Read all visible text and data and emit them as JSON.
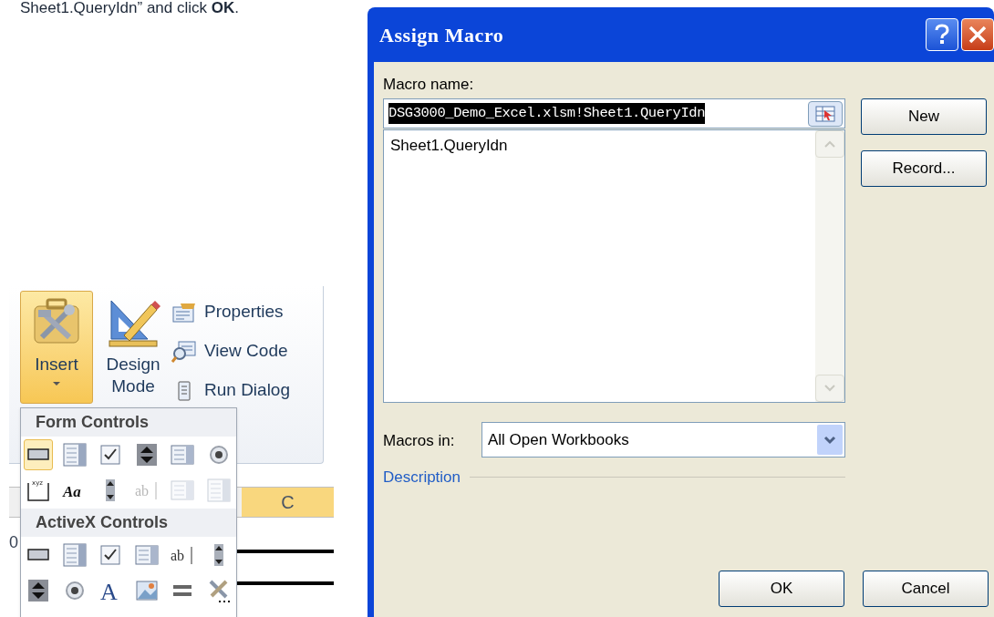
{
  "doc_text": "Sheet1.QueryIdn” and click **OK**.",
  "ribbon": {
    "big_buttons": [
      {
        "kind": "insert",
        "label": "Insert",
        "selected": true
      },
      {
        "kind": "design",
        "label": "Design Mode",
        "selected": false
      }
    ],
    "small_buttons": [
      {
        "kind": "properties",
        "label": "Properties"
      },
      {
        "kind": "viewcode",
        "label": "View Code"
      },
      {
        "kind": "rundialog",
        "label": "Run Dialog"
      }
    ]
  },
  "controls_menu": {
    "sections": [
      {
        "title": "Form Controls",
        "items": [
          {
            "kind": "button",
            "selected": true,
            "disabled": false
          },
          {
            "kind": "combo",
            "selected": false,
            "disabled": false
          },
          {
            "kind": "checkbox",
            "selected": false,
            "disabled": false
          },
          {
            "kind": "spin",
            "selected": false,
            "disabled": false
          },
          {
            "kind": "list",
            "selected": false,
            "disabled": false
          },
          {
            "kind": "option",
            "selected": false,
            "disabled": false
          },
          {
            "kind": "groupbox",
            "glyph": "xyz",
            "selected": false,
            "disabled": false
          },
          {
            "kind": "label",
            "glyph": "Aa",
            "selected": false,
            "disabled": false
          },
          {
            "kind": "scrollbar",
            "selected": false,
            "disabled": false
          },
          {
            "kind": "textfield",
            "glyph": "ab",
            "selected": false,
            "disabled": true
          },
          {
            "kind": "list",
            "selected": false,
            "disabled": true
          },
          {
            "kind": "combo",
            "selected": false,
            "disabled": true
          }
        ]
      },
      {
        "title": "ActiveX Controls",
        "items": [
          {
            "kind": "button",
            "selected": false,
            "disabled": false
          },
          {
            "kind": "combo",
            "selected": false,
            "disabled": false
          },
          {
            "kind": "checkbox",
            "selected": false,
            "disabled": false
          },
          {
            "kind": "list",
            "selected": false,
            "disabled": false
          },
          {
            "kind": "textfield",
            "glyph": "ab",
            "selected": false,
            "disabled": false
          },
          {
            "kind": "scrollbar",
            "selected": false,
            "disabled": false
          },
          {
            "kind": "spin",
            "selected": false,
            "disabled": false
          },
          {
            "kind": "option",
            "selected": false,
            "disabled": false
          },
          {
            "kind": "text",
            "glyph": "A",
            "selected": false,
            "disabled": false
          },
          {
            "kind": "image",
            "selected": false,
            "disabled": false
          },
          {
            "kind": "toggle",
            "selected": false,
            "disabled": false
          },
          {
            "kind": "more",
            "selected": false,
            "disabled": false
          }
        ]
      }
    ]
  },
  "sheet": {
    "column_header": "C",
    "cell_fragment": "0"
  },
  "dialog": {
    "title": "Assign Macro",
    "macro_name_label": "Macro name:",
    "macro_name_value": "DSG3000_Demo_Excel.xlsm!Sheet1.QueryIdn",
    "macros": [
      {
        "name": "Sheet1.QueryIdn",
        "selected": false
      }
    ],
    "side_buttons": [
      "New",
      "Record..."
    ],
    "macros_in_label": "Macros in:",
    "macros_in_value": "All Open Workbooks",
    "description_label": "Description",
    "bottom_buttons": [
      "OK",
      "Cancel"
    ]
  }
}
